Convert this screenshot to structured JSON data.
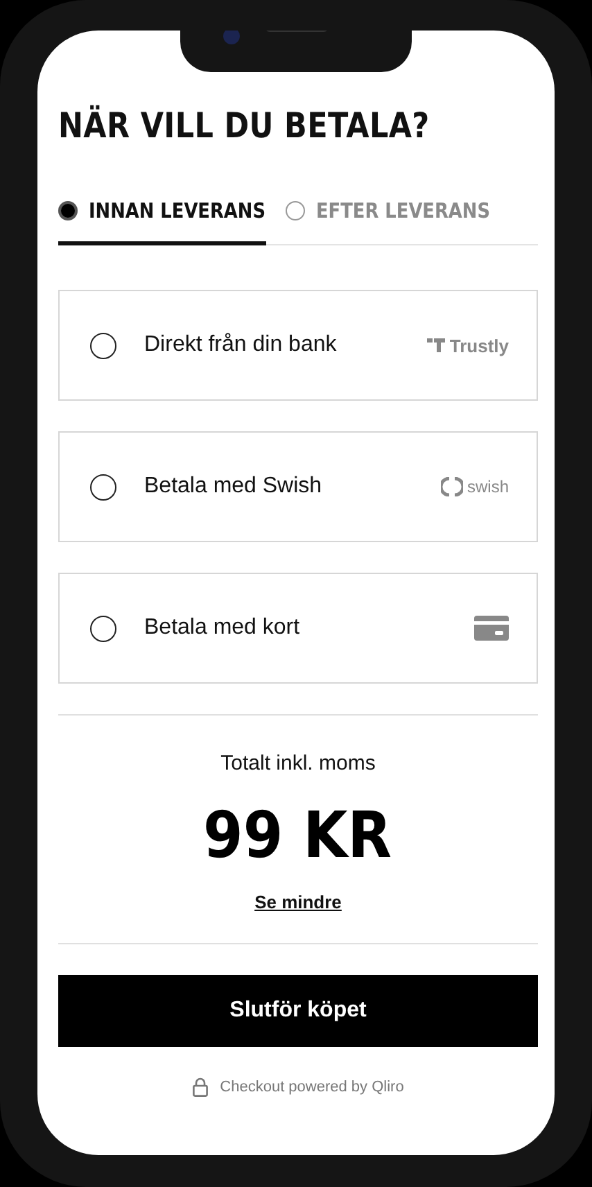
{
  "title": "NÄR VILL DU BETALA?",
  "tabs": [
    {
      "label": "INNAN LEVERANS",
      "selected": true
    },
    {
      "label": "EFTER LEVERANS",
      "selected": false
    }
  ],
  "payment_options": [
    {
      "label": "Direkt från din bank",
      "selected": false,
      "kind": "trustly",
      "logo_text": "Trustly"
    },
    {
      "label": "Betala med Swish",
      "selected": false,
      "kind": "swish",
      "logo_text": "swish"
    },
    {
      "label": "Betala med kort",
      "selected": false,
      "kind": "card"
    }
  ],
  "total": {
    "label": "Totalt inkl. moms",
    "amount": "99 KR",
    "toggle": "Se mindre"
  },
  "submit_button": "Slutför köpet",
  "footer": "Checkout powered by Qliro"
}
